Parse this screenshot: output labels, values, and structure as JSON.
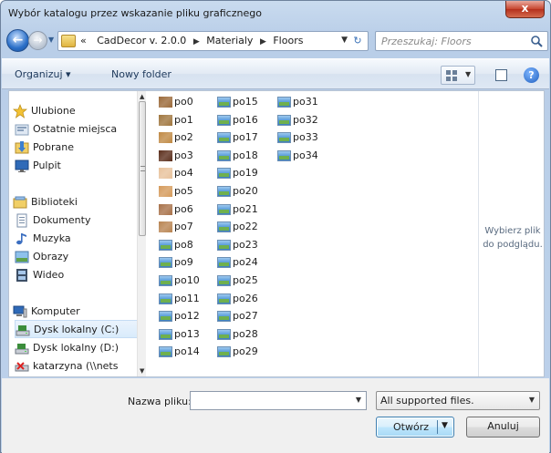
{
  "window": {
    "title": "Wybór katalogu przez wskazanie pliku graficznego",
    "close_label": "x"
  },
  "nav": {
    "breadcrumb_prefix": "«",
    "breadcrumbs": [
      "CadDecor v. 2.0.0",
      "Materialy",
      "Floors"
    ],
    "search_placeholder": "Przeszukaj: Floors"
  },
  "toolbar": {
    "organize_label": "Organizuj ▾",
    "new_folder_label": "Nowy folder"
  },
  "sidebar": {
    "items": [
      {
        "label": "Ulubione",
        "icon": "star-icon",
        "group": true
      },
      {
        "label": "Ostatnie miejsca",
        "icon": "recent-places-icon"
      },
      {
        "label": "Pobrane",
        "icon": "downloads-folder-icon"
      },
      {
        "label": "Pulpit",
        "icon": "desktop-icon"
      },
      {
        "label": "Biblioteki",
        "icon": "libraries-icon",
        "group": true
      },
      {
        "label": "Dokumenty",
        "icon": "documents-icon"
      },
      {
        "label": "Muzyka",
        "icon": "music-icon"
      },
      {
        "label": "Obrazy",
        "icon": "pictures-icon"
      },
      {
        "label": "Wideo",
        "icon": "video-icon"
      },
      {
        "label": "Komputer",
        "icon": "computer-icon",
        "group": true
      },
      {
        "label": "Dysk lokalny (C:)",
        "icon": "local-disk-icon",
        "selected": true
      },
      {
        "label": "Dysk lokalny (D:)",
        "icon": "local-disk-icon"
      },
      {
        "label": "katarzyna (\\\\nets",
        "icon": "network-drive-icon"
      }
    ]
  },
  "files": [
    {
      "name": "po0",
      "texture": "#9b6a3a"
    },
    {
      "name": "po1",
      "texture": "#a0773f"
    },
    {
      "name": "po2",
      "texture": "#c08a45"
    },
    {
      "name": "po3",
      "texture": "#5c2f1d"
    },
    {
      "name": "po4",
      "texture": "#e8c29c"
    },
    {
      "name": "po5",
      "texture": "#d59b5c"
    },
    {
      "name": "po6",
      "texture": "#a8724a"
    },
    {
      "name": "po7",
      "texture": "#b98553"
    },
    {
      "name": "po8"
    },
    {
      "name": "po9"
    },
    {
      "name": "po10"
    },
    {
      "name": "po11"
    },
    {
      "name": "po12"
    },
    {
      "name": "po13"
    },
    {
      "name": "po14"
    },
    {
      "name": "po15"
    },
    {
      "name": "po16"
    },
    {
      "name": "po17"
    },
    {
      "name": "po18"
    },
    {
      "name": "po19"
    },
    {
      "name": "po20"
    },
    {
      "name": "po21"
    },
    {
      "name": "po22"
    },
    {
      "name": "po23"
    },
    {
      "name": "po24"
    },
    {
      "name": "po25"
    },
    {
      "name": "po26"
    },
    {
      "name": "po27"
    },
    {
      "name": "po28"
    },
    {
      "name": "po29"
    },
    {
      "name": "po31"
    },
    {
      "name": "po32"
    },
    {
      "name": "po33"
    },
    {
      "name": "po34"
    }
  ],
  "preview": {
    "text": "Wybierz plik do podglądu."
  },
  "bottom": {
    "filename_label": "Nazwa pliku:",
    "filename_value": "",
    "filetype_value": "All supported files.",
    "open_label": "Otwórz",
    "cancel_label": "Anuluj"
  }
}
